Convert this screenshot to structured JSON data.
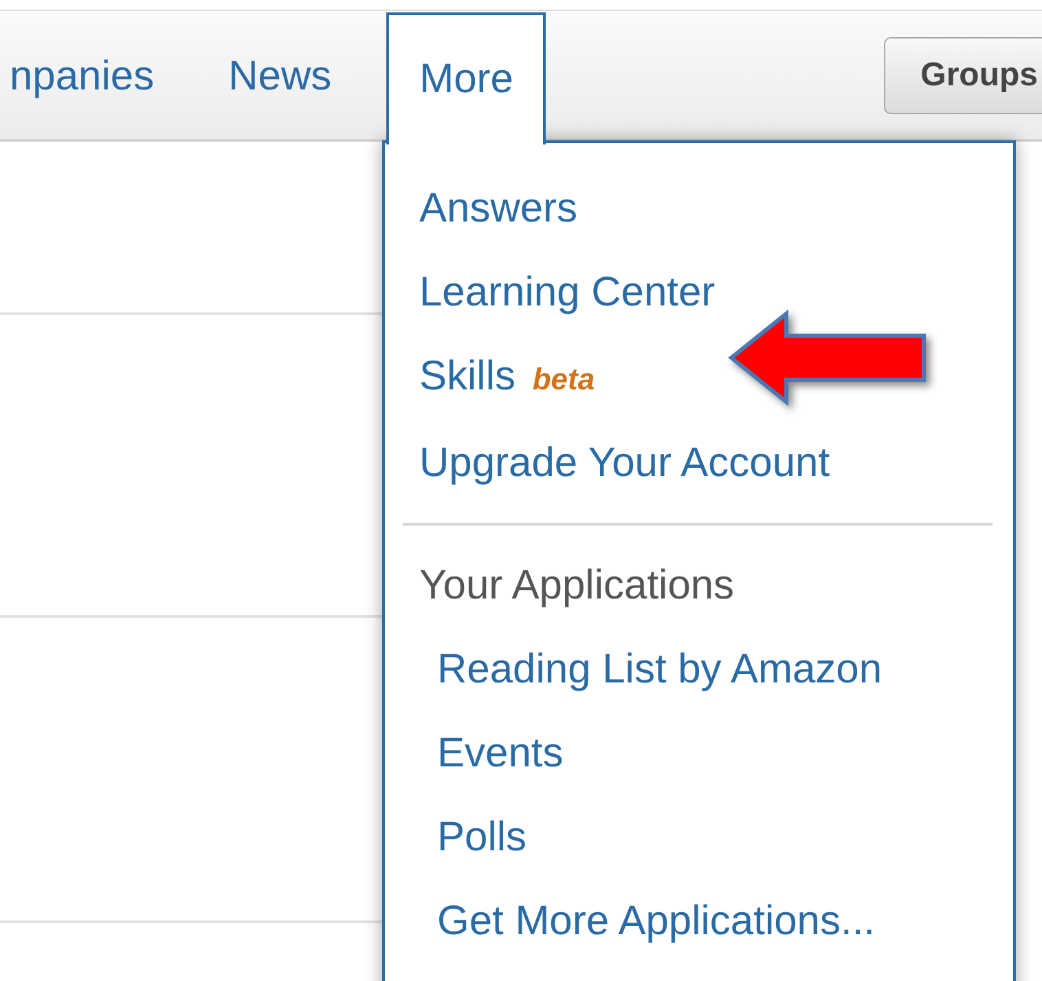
{
  "nav": {
    "tabs": [
      {
        "label": "npanies",
        "selected": false
      },
      {
        "label": "News",
        "selected": false
      },
      {
        "label": "More",
        "selected": true
      }
    ],
    "groups_button": "Groups"
  },
  "menu": {
    "items": [
      {
        "label": "Answers"
      },
      {
        "label": "Learning Center"
      },
      {
        "label": "Skills",
        "badge": "beta"
      },
      {
        "label": "Upgrade Your Account"
      }
    ],
    "section": {
      "title": "Your Applications",
      "items": [
        {
          "label": "Reading List by Amazon"
        },
        {
          "label": "Events"
        },
        {
          "label": "Polls"
        },
        {
          "label": "Get More Applications..."
        }
      ]
    }
  }
}
